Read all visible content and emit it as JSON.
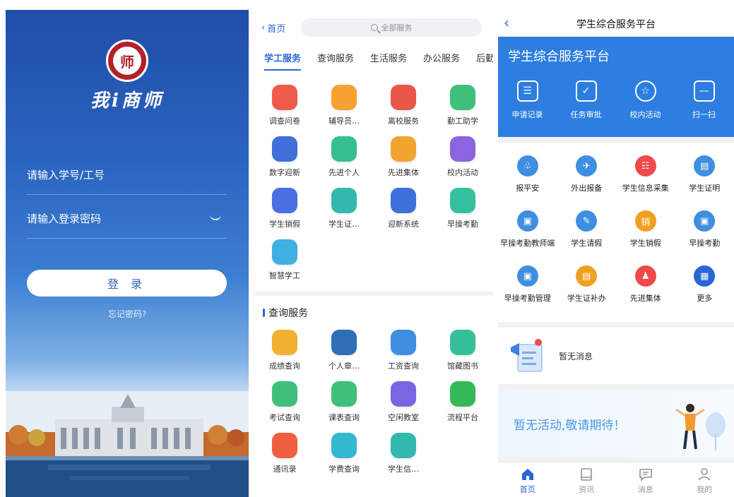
{
  "login": {
    "user_placeholder": "请输入学号/工号",
    "pass_placeholder": "请输入登录密码",
    "login_label": "登 录",
    "forgot_label": "忘记密码?",
    "brand_text": "我i商师"
  },
  "services": {
    "back_label": "首页",
    "search_placeholder": "全部服务",
    "tabs": [
      "学工服务",
      "查询服务",
      "生活服务",
      "办公服务",
      "后勤E"
    ],
    "section1_items": [
      {
        "label": "调查问卷",
        "icon": "survey-icon",
        "color": "#ef5b4b"
      },
      {
        "label": "辅导员…",
        "icon": "counselor-icon",
        "color": "#f5a232"
      },
      {
        "label": "离校服务",
        "icon": "leave-school-icon",
        "color": "#e9564a"
      },
      {
        "label": "勤工助学",
        "icon": "work-study-icon",
        "color": "#3fbf7a"
      },
      {
        "label": "数字迎新",
        "icon": "digital-welcome-icon",
        "color": "#3f6fd8"
      },
      {
        "label": "先进个人",
        "icon": "advanced-person-icon",
        "color": "#33c08d"
      },
      {
        "label": "先进集体",
        "icon": "advanced-group-icon",
        "color": "#f0a530"
      },
      {
        "label": "校内活动",
        "icon": "campus-activity-icon",
        "color": "#8b64e0"
      },
      {
        "label": "学生销假",
        "icon": "leave-cancel-icon",
        "color": "#4a6fe0"
      },
      {
        "label": "学生证…",
        "icon": "student-id-icon",
        "color": "#33b8b0"
      },
      {
        "label": "迎新系统",
        "icon": "welcome-system-icon",
        "color": "#3f6fd8"
      },
      {
        "label": "早操考勤",
        "icon": "morning-exercise-icon",
        "color": "#35c0a0"
      },
      {
        "label": "智慧学工",
        "icon": "smart-work-icon",
        "color": "#3fb0e0"
      }
    ],
    "section2_title": "查询服务",
    "section2_items": [
      {
        "label": "成绩查询",
        "icon": "grades-icon",
        "color": "#f0b230"
      },
      {
        "label": "个人章…",
        "icon": "personal-seal-icon",
        "color": "#2f6fb8"
      },
      {
        "label": "工资查询",
        "icon": "salary-icon",
        "color": "#3f8fe0"
      },
      {
        "label": "馆藏图书",
        "icon": "library-icon",
        "color": "#35c09a"
      },
      {
        "label": "考试查询",
        "icon": "exam-icon",
        "color": "#3fbf7a"
      },
      {
        "label": "课表查询",
        "icon": "timetable-icon",
        "color": "#3fbf7a"
      },
      {
        "label": "空闲教室",
        "icon": "classroom-icon",
        "color": "#7a66e0"
      },
      {
        "label": "流程平台",
        "icon": "workflow-icon",
        "color": "#33b85a"
      },
      {
        "label": "通讯录",
        "icon": "contacts-icon",
        "color": "#ef6040"
      },
      {
        "label": "学费查询",
        "icon": "tuition-icon",
        "color": "#33b8d0"
      },
      {
        "label": "学生信…",
        "icon": "student-info-icon",
        "color": "#33b8b0"
      }
    ]
  },
  "platform": {
    "nav_title": "学生综合服务平台",
    "banner_title": "学生综合服务平台",
    "quick_actions": [
      {
        "label": "申请记录",
        "icon": "application-record-icon",
        "glyph": "☰"
      },
      {
        "label": "任务审批",
        "icon": "task-approve-icon",
        "glyph": "✓"
      },
      {
        "label": "校内活动",
        "icon": "campus-activity-icon",
        "glyph": "☆"
      },
      {
        "label": "扫一扫",
        "icon": "scan-icon",
        "glyph": "—"
      }
    ],
    "grid_items": [
      {
        "label": "报平安",
        "icon": "safety-report-icon",
        "color": "#3f8fe0",
        "glyph": "♧"
      },
      {
        "label": "外出报备",
        "icon": "outing-report-icon",
        "color": "#3f8fe0",
        "glyph": "✈"
      },
      {
        "label": "学生信息采集",
        "icon": "info-collect-icon",
        "color": "#ef4a4a",
        "glyph": "☷"
      },
      {
        "label": "学生证明",
        "icon": "certificate-icon",
        "color": "#3f8fe0",
        "glyph": "▤"
      },
      {
        "label": "早操考勤教师端",
        "icon": "teacher-attendance-icon",
        "color": "#3f8fe0",
        "glyph": "▣"
      },
      {
        "label": "学生请假",
        "icon": "leave-request-icon",
        "color": "#3f8fe0",
        "glyph": "✎"
      },
      {
        "label": "学生销假",
        "icon": "leave-cancel-icon",
        "color": "#f0a020",
        "glyph": "销"
      },
      {
        "label": "早操考勤",
        "icon": "morning-attendance-icon",
        "color": "#3f8fe0",
        "glyph": "▣"
      },
      {
        "label": "早操考勤管理",
        "icon": "attendance-manage-icon",
        "color": "#3f8fe0",
        "glyph": "▣"
      },
      {
        "label": "学生证补办",
        "icon": "id-reissue-icon",
        "color": "#f0a020",
        "glyph": "▤"
      },
      {
        "label": "先进集体",
        "icon": "advanced-group-icon",
        "color": "#ef4a4a",
        "glyph": "♟"
      },
      {
        "label": "更多",
        "icon": "more-icon",
        "color": "#2a66d6",
        "glyph": "▦"
      }
    ],
    "message_text": "暂无消息",
    "activity_text": "暂无活动,敬请期待！",
    "bottom_nav": [
      {
        "label": "首页",
        "icon": "home-icon"
      },
      {
        "label": "资讯",
        "icon": "news-icon"
      },
      {
        "label": "消息",
        "icon": "message-icon"
      },
      {
        "label": "我的",
        "icon": "profile-icon"
      }
    ]
  }
}
